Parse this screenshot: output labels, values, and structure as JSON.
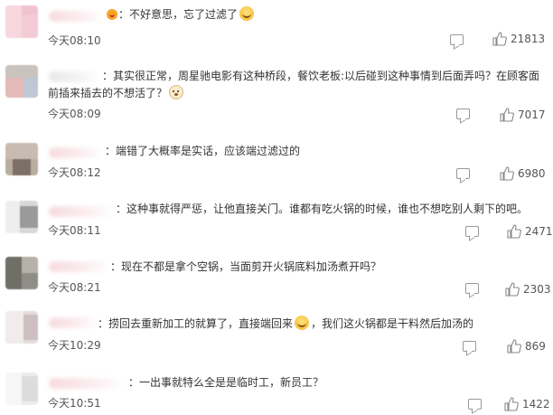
{
  "comments": [
    {
      "text": "：不好意思，忘了过滤了",
      "time": "今天08:10",
      "likes": "21813",
      "suffix_emoji": "laugh-emoji",
      "prefix_emoji": "smile-badge"
    },
    {
      "text_line1": "：其实很正常，周星驰电影有这种桥段，餐饮老板:以后碰到这种事情到后面弄吗？在顾客面",
      "text_line2": "前插来插去的不想活了？",
      "time": "今天08:09",
      "likes": "7017",
      "suffix_emoji": "dog-emoji"
    },
    {
      "text": "：端错了大概率是实话，应该端过滤过的",
      "time": "今天08:12",
      "likes": "6980"
    },
    {
      "text": "：这种事就得严惩，让他直接关门。谁都有吃火锅的时候，谁也不想吃别人剩下的吧。",
      "time": "今天08:11",
      "likes": "2471"
    },
    {
      "text": "：现在不都是拿个空锅，当面剪开火锅底料加汤煮开吗？",
      "time": "今天08:21",
      "likes": "2303"
    },
    {
      "text_before": "：捞回去重新加工的就算了，直接端回来",
      "text_after": "，我们这火锅都是干料然后加汤的",
      "time": "今天10:29",
      "likes": "869",
      "mid_emoji": "laugh-emoji"
    },
    {
      "text": "：一出事就特么全是是临时工，新员工？",
      "time": "今天10:51",
      "likes": "1422"
    }
  ]
}
